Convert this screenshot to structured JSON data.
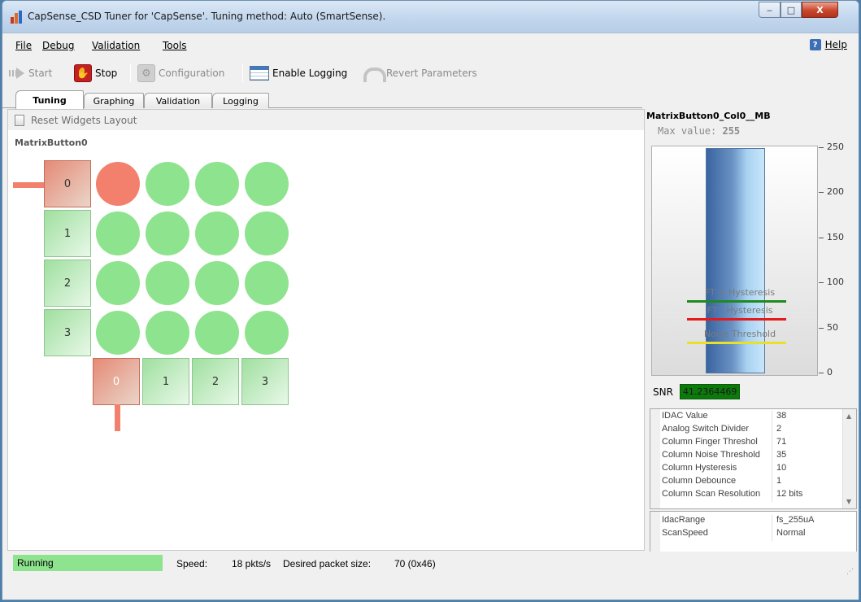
{
  "window": {
    "title": "CapSense_CSD Tuner for 'CapSense'. Tuning method: Auto (SmartSense).",
    "minimize": "‒",
    "maximize": "□",
    "close": "X"
  },
  "menu": {
    "items": [
      {
        "label": "File"
      },
      {
        "label": "Debug"
      },
      {
        "label": "Validation"
      },
      {
        "label": "Tools"
      }
    ],
    "help_label": "Help",
    "help_icon": "?"
  },
  "toolbar": {
    "start_label": "Start",
    "stop_label": "Stop",
    "configuration_label": "Configuration",
    "enable_logging_label": "Enable Logging",
    "revert_label": "Revert Parameters"
  },
  "tabs": [
    {
      "label": "Tuning",
      "active": true
    },
    {
      "label": "Graphing",
      "active": false
    },
    {
      "label": "Validation",
      "active": false
    },
    {
      "label": "Logging",
      "active": false
    }
  ],
  "tuning": {
    "reset_label": "Reset Widgets Layout",
    "widget_name": "MatrixButton0",
    "rows": [
      "0",
      "1",
      "2",
      "3"
    ],
    "columns": [
      "0",
      "1",
      "2",
      "3"
    ],
    "active_row": 0,
    "active_column": 0
  },
  "sensor": {
    "name": "MatrixButton0_Col0__MB",
    "max_label": "Max value:",
    "max_value": "255",
    "axis_ticks": [
      "250",
      "200",
      "150",
      "100",
      "50",
      "0"
    ],
    "ymax": 250,
    "current_value": 250,
    "thresholds": [
      {
        "label": "FT + Hysteresis",
        "value": 81,
        "color": "#1f8a1f"
      },
      {
        "label": "FT - Hysteresis",
        "value": 61,
        "color": "#e31b1b"
      },
      {
        "label": "Noise Threshold",
        "value": 35,
        "color": "#e8e02a"
      }
    ],
    "snr_label": "SNR",
    "snr_value": "41.2364469"
  },
  "properties": [
    {
      "name": "IDAC Value",
      "value": "38"
    },
    {
      "name": "Analog Switch Divider",
      "value": "2"
    },
    {
      "name": "Column Finger Threshol",
      "value": "71"
    },
    {
      "name": "Column Noise Threshold",
      "value": "35"
    },
    {
      "name": "Column Hysteresis",
      "value": "10"
    },
    {
      "name": "Column Debounce",
      "value": "1"
    },
    {
      "name": "Column Scan Resolution",
      "value": "12 bits"
    }
  ],
  "properties2": [
    {
      "name": "IdacRange",
      "value": "fs_255uA"
    },
    {
      "name": "ScanSpeed",
      "value": "Normal"
    }
  ],
  "status": {
    "state": "Running",
    "speed_label": "Speed:",
    "speed_value": "18 pkts/s",
    "packet_label": "Desired packet size:",
    "packet_value": "70 (0x46)",
    "running_color": "#8ee38e"
  }
}
